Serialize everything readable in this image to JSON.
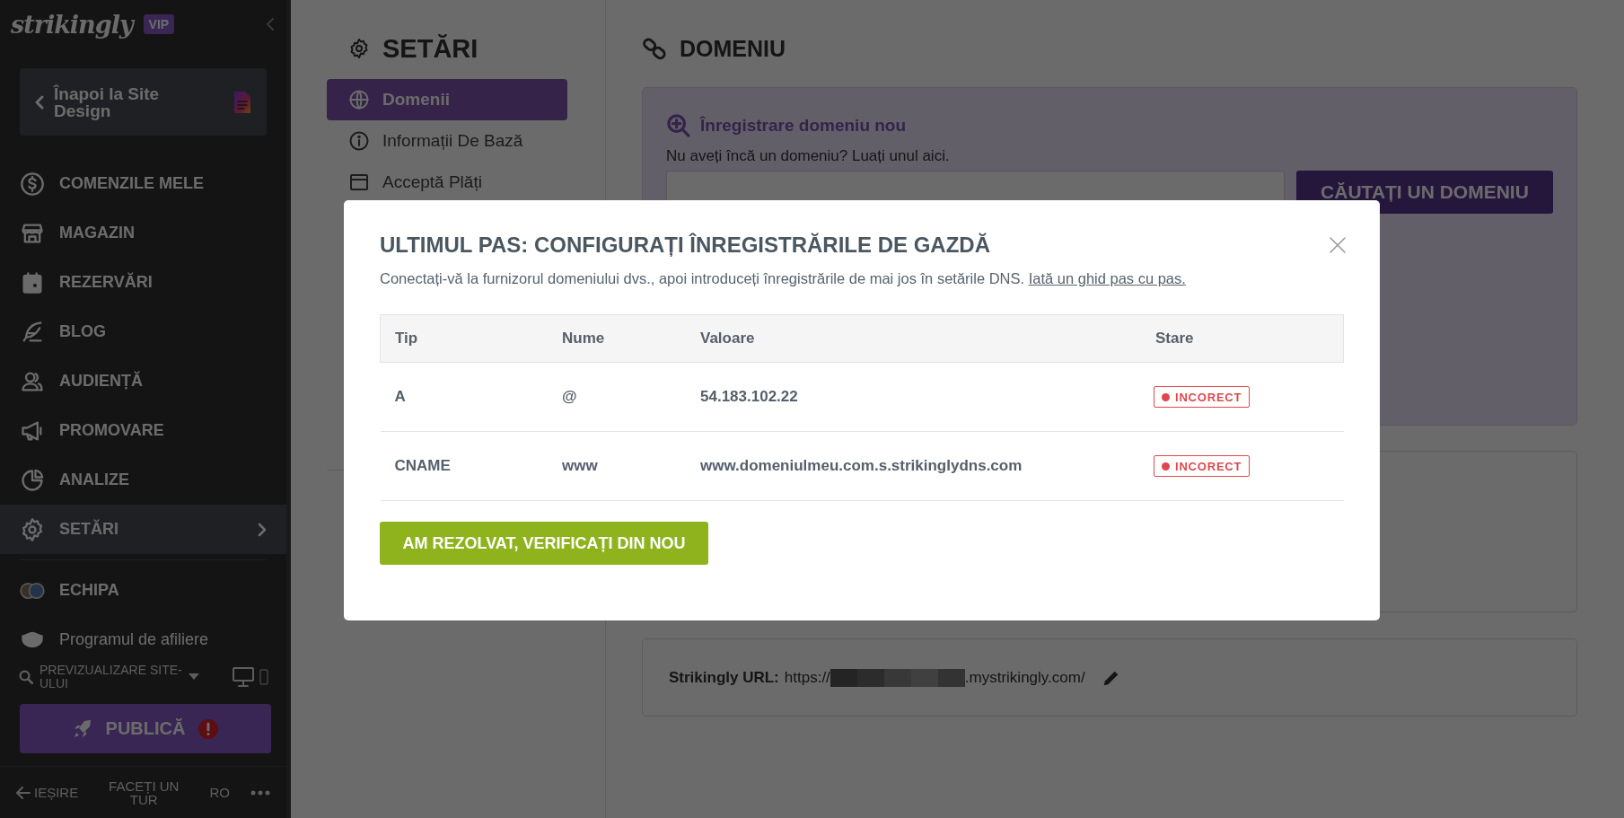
{
  "sidebar": {
    "logo": "strikingly",
    "badge": "VIP",
    "back_button": "Înapoi la Site Design",
    "items": [
      {
        "label": "COMENZILE MELE",
        "selected": false
      },
      {
        "label": "MAGAZIN",
        "selected": false
      },
      {
        "label": "REZERVĂRI",
        "selected": false
      },
      {
        "label": "BLOG",
        "selected": false
      },
      {
        "label": "AUDIENȚĂ",
        "selected": false
      },
      {
        "label": "PROMOVARE",
        "selected": false
      },
      {
        "label": "ANALIZE",
        "selected": false
      },
      {
        "label": "SETĂRI",
        "selected": true
      }
    ],
    "secondary_items": [
      {
        "label": "ECHIPA"
      },
      {
        "label": "Programul de afiliere"
      }
    ],
    "preview": "PREVIZUALIZARE SITE-ULUI",
    "publish_button": "PUBLICĂ",
    "footer": {
      "exit": "IEȘIRE",
      "tour": "FACEȚI UN TUR",
      "language": "RO"
    }
  },
  "settings": {
    "title": "SETĂRI",
    "items": [
      {
        "label": "Domenii",
        "selected": true
      },
      {
        "label": "Informații De Bază",
        "selected": false
      },
      {
        "label": "Acceptă Plăți",
        "selected": false
      }
    ]
  },
  "domain": {
    "title": "DOMENIU",
    "register": {
      "heading": "Înregistrare domeniu nou",
      "text": "Nu aveți încă un domeniu? Luați unul aici.",
      "button": "CĂUTAȚI UN DOMENIU"
    },
    "url": {
      "label": "Strikingly URL:",
      "prefix": "https://",
      "suffix": ".mystrikingly.com/"
    }
  },
  "modal": {
    "title": "ULTIMUL PAS: CONFIGURAȚI ÎNREGISTRĂRILE DE GAZDĂ",
    "description": "Conectați-vă la furnizorul domeniului dvs., apoi introduceți înregistrările de mai jos în setările DNS.",
    "link": "Iată un ghid pas cu pas.",
    "columns": [
      "Tip",
      "Nume",
      "Valoare",
      "Stare"
    ],
    "rows": [
      {
        "cells": [
          "A",
          "@",
          "54.183.102.22"
        ],
        "status": {
          "label": "INCORECT",
          "kind": "error"
        }
      },
      {
        "cells": [
          "CNAME",
          "www",
          "www.domeniulmeu.com.s.strikinglydns.com"
        ],
        "status": {
          "label": "INCORECT",
          "kind": "error"
        }
      }
    ],
    "button": "AM REZOLVAT, VERIFICAȚI DIN NOU"
  }
}
